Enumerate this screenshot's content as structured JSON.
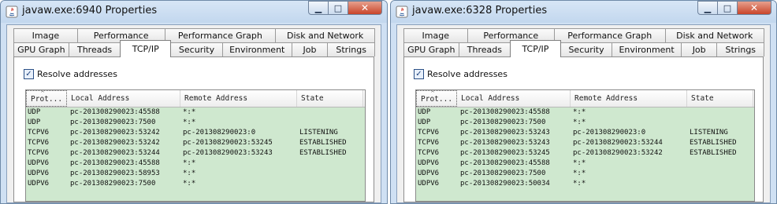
{
  "windows": [
    {
      "title": "javaw.exe:6940 Properties",
      "tabs_row1": [
        "Image",
        "Performance",
        "Performance Graph",
        "Disk and Network"
      ],
      "tabs_row2": [
        "GPU Graph",
        "Threads",
        "TCP/IP",
        "Security",
        "Environment",
        "Job",
        "Strings"
      ],
      "active_tab": "TCP/IP",
      "resolve_label": "Resolve addresses",
      "resolve_checked": true,
      "columns": [
        "Prot...",
        "Local Address",
        "Remote Address",
        "State"
      ],
      "rows": [
        [
          "UDP",
          "pc-201308290023:45588",
          "*:*",
          ""
        ],
        [
          "UDP",
          "pc-201308290023:7500",
          "*:*",
          ""
        ],
        [
          "TCPV6",
          "pc-201308290023:53242",
          "pc-201308290023:0",
          "LISTENING"
        ],
        [
          "TCPV6",
          "pc-201308290023:53242",
          "pc-201308290023:53245",
          "ESTABLISHED"
        ],
        [
          "TCPV6",
          "pc-201308290023:53244",
          "pc-201308290023:53243",
          "ESTABLISHED"
        ],
        [
          "UDPV6",
          "pc-201308290023:45588",
          "*:*",
          ""
        ],
        [
          "UDPV6",
          "pc-201308290023:58953",
          "*:*",
          ""
        ],
        [
          "UDPV6",
          "pc-201308290023:7500",
          "*:*",
          ""
        ]
      ]
    },
    {
      "title": "javaw.exe:6328 Properties",
      "tabs_row1": [
        "Image",
        "Performance",
        "Performance Graph",
        "Disk and Network"
      ],
      "tabs_row2": [
        "GPU Graph",
        "Threads",
        "TCP/IP",
        "Security",
        "Environment",
        "Job",
        "Strings"
      ],
      "active_tab": "TCP/IP",
      "resolve_label": "Resolve addresses",
      "resolve_checked": true,
      "columns": [
        "Prot...",
        "Local Address",
        "Remote Address",
        "State"
      ],
      "rows": [
        [
          "UDP",
          "pc-201308290023:45588",
          "*:*",
          ""
        ],
        [
          "UDP",
          "pc-201308290023:7500",
          "*:*",
          ""
        ],
        [
          "TCPV6",
          "pc-201308290023:53243",
          "pc-201308290023:0",
          "LISTENING"
        ],
        [
          "TCPV6",
          "pc-201308290023:53243",
          "pc-201308290023:53244",
          "ESTABLISHED"
        ],
        [
          "TCPV6",
          "pc-201308290023:53245",
          "pc-201308290023:53242",
          "ESTABLISHED"
        ],
        [
          "UDPV6",
          "pc-201308290023:45588",
          "*:*",
          ""
        ],
        [
          "UDPV6",
          "pc-201308290023:7500",
          "*:*",
          ""
        ],
        [
          "UDPV6",
          "pc-201308290023:50034",
          "*:*",
          ""
        ]
      ]
    }
  ],
  "caption_buttons": {
    "minimize": "▁",
    "maximize": "□",
    "close": "✕"
  },
  "checkbox_mark": "✓",
  "sort_indicator": "^",
  "colors": {
    "row_bg": "#cfe8cf",
    "titlebar": "#c8daef",
    "close_button": "#c9452a"
  }
}
